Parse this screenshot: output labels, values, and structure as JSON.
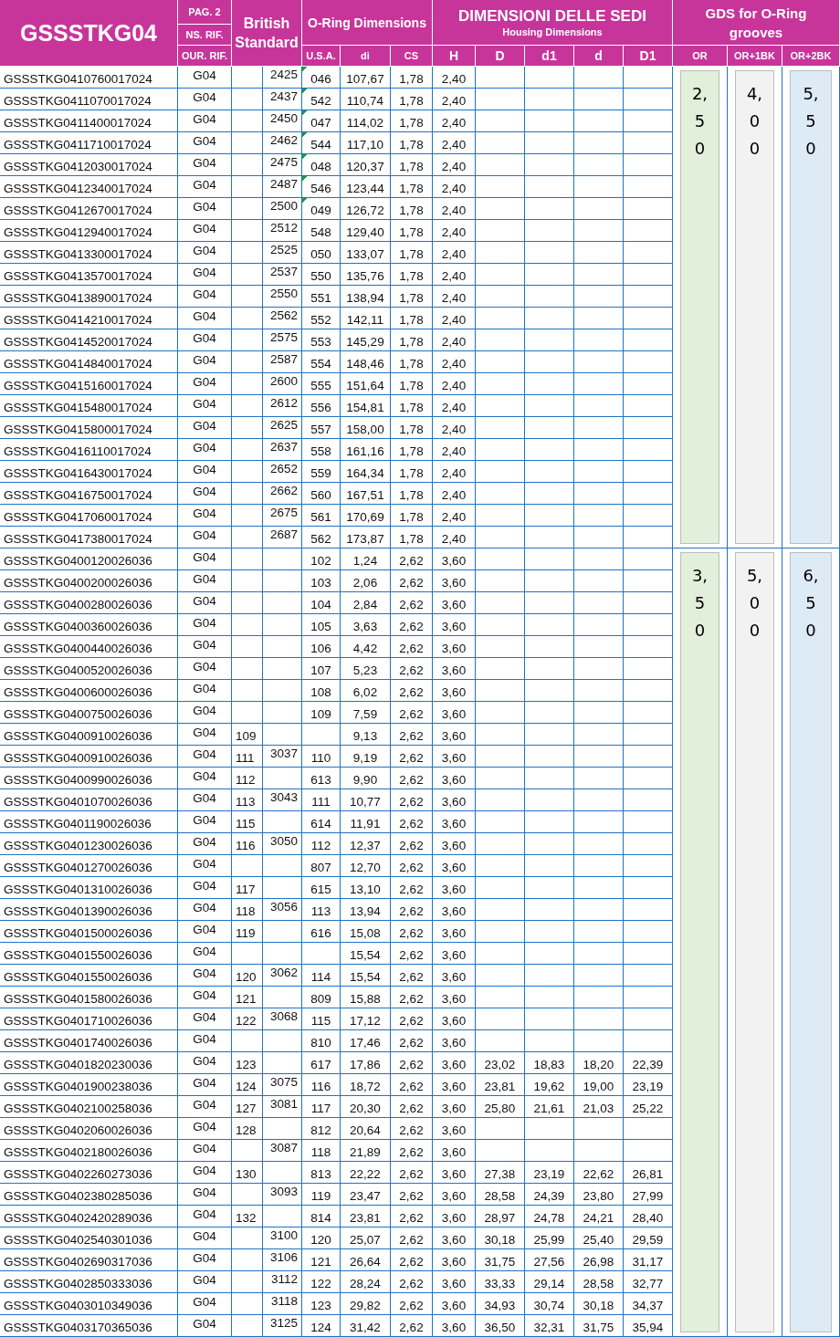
{
  "header": {
    "title": "GSSSTKG04",
    "ref_labels": [
      "PAG. 2",
      "NS. RIF.",
      "OUR. RIF."
    ],
    "bs_title": "British Standard",
    "oring_title": "O-Ring Dimensions",
    "oring_columns": [
      "U.S.A.",
      "di",
      "CS"
    ],
    "housing_title": "DIMENSIONI DELLE SEDI",
    "housing_subtitle": "Housing Dimensions",
    "housing_columns": [
      "H",
      "D",
      "d1",
      "d",
      "D1"
    ],
    "grooves_title": "GDS for O-Ring grooves",
    "grooves_columns": [
      "OR",
      "OR+1BK",
      "OR+2BK"
    ]
  },
  "sections": [
    {
      "grooves": [
        "2,50",
        "4,00",
        "5,50"
      ],
      "rows": [
        {
          "code": "GSSSTKG0410760017024",
          "ref": "G04",
          "bs_b": "2425",
          "usa": "046",
          "di": "107,67",
          "cs": "1,78",
          "H": "2,40",
          "flagged": true
        },
        {
          "code": "GSSSTKG0411070017024",
          "ref": "G04",
          "bs_b": "2437",
          "usa": "542",
          "di": "110,74",
          "cs": "1,78",
          "H": "2,40",
          "flagged": true
        },
        {
          "code": "GSSSTKG0411400017024",
          "ref": "G04",
          "bs_b": "2450",
          "usa": "047",
          "di": "114,02",
          "cs": "1,78",
          "H": "2,40",
          "flagged": true
        },
        {
          "code": "GSSSTKG0411710017024",
          "ref": "G04",
          "bs_b": "2462",
          "usa": "544",
          "di": "117,10",
          "cs": "1,78",
          "H": "2,40",
          "flagged": true
        },
        {
          "code": "GSSSTKG0412030017024",
          "ref": "G04",
          "bs_b": "2475",
          "usa": "048",
          "di": "120,37",
          "cs": "1,78",
          "H": "2,40",
          "flagged": true
        },
        {
          "code": "GSSSTKG0412340017024",
          "ref": "G04",
          "bs_b": "2487",
          "usa": "546",
          "di": "123,44",
          "cs": "1,78",
          "H": "2,40",
          "flagged": true
        },
        {
          "code": "GSSSTKG0412670017024",
          "ref": "G04",
          "bs_b": "2500",
          "usa": "049",
          "di": "126,72",
          "cs": "1,78",
          "H": "2,40",
          "flagged": true
        },
        {
          "code": "GSSSTKG0412940017024",
          "ref": "G04",
          "bs_b": "2512",
          "usa": "548",
          "di": "129,40",
          "cs": "1,78",
          "H": "2,40",
          "flagged": false
        },
        {
          "code": "GSSSTKG0413300017024",
          "ref": "G04",
          "bs_b": "2525",
          "usa": "050",
          "di": "133,07",
          "cs": "1,78",
          "H": "2,40",
          "flagged": false
        },
        {
          "code": "GSSSTKG0413570017024",
          "ref": "G04",
          "bs_b": "2537",
          "usa": "550",
          "di": "135,76",
          "cs": "1,78",
          "H": "2,40",
          "flagged": false
        },
        {
          "code": "GSSSTKG0413890017024",
          "ref": "G04",
          "bs_b": "2550",
          "usa": "551",
          "di": "138,94",
          "cs": "1,78",
          "H": "2,40",
          "flagged": false
        },
        {
          "code": "GSSSTKG0414210017024",
          "ref": "G04",
          "bs_b": "2562",
          "usa": "552",
          "di": "142,11",
          "cs": "1,78",
          "H": "2,40",
          "flagged": false
        },
        {
          "code": "GSSSTKG0414520017024",
          "ref": "G04",
          "bs_b": "2575",
          "usa": "553",
          "di": "145,29",
          "cs": "1,78",
          "H": "2,40",
          "flagged": false
        },
        {
          "code": "GSSSTKG0414840017024",
          "ref": "G04",
          "bs_b": "2587",
          "usa": "554",
          "di": "148,46",
          "cs": "1,78",
          "H": "2,40",
          "flagged": false
        },
        {
          "code": "GSSSTKG0415160017024",
          "ref": "G04",
          "bs_b": "2600",
          "usa": "555",
          "di": "151,64",
          "cs": "1,78",
          "H": "2,40",
          "flagged": false
        },
        {
          "code": "GSSSTKG0415480017024",
          "ref": "G04",
          "bs_b": "2612",
          "usa": "556",
          "di": "154,81",
          "cs": "1,78",
          "H": "2,40",
          "flagged": false
        },
        {
          "code": "GSSSTKG0415800017024",
          "ref": "G04",
          "bs_b": "2625",
          "usa": "557",
          "di": "158,00",
          "cs": "1,78",
          "H": "2,40",
          "flagged": false
        },
        {
          "code": "GSSSTKG0416110017024",
          "ref": "G04",
          "bs_b": "2637",
          "usa": "558",
          "di": "161,16",
          "cs": "1,78",
          "H": "2,40",
          "flagged": false
        },
        {
          "code": "GSSSTKG0416430017024",
          "ref": "G04",
          "bs_b": "2652",
          "usa": "559",
          "di": "164,34",
          "cs": "1,78",
          "H": "2,40",
          "flagged": false
        },
        {
          "code": "GSSSTKG0416750017024",
          "ref": "G04",
          "bs_b": "2662",
          "usa": "560",
          "di": "167,51",
          "cs": "1,78",
          "H": "2,40",
          "flagged": false
        },
        {
          "code": "GSSSTKG0417060017024",
          "ref": "G04",
          "bs_b": "2675",
          "usa": "561",
          "di": "170,69",
          "cs": "1,78",
          "H": "2,40",
          "flagged": false
        },
        {
          "code": "GSSSTKG0417380017024",
          "ref": "G04",
          "bs_b": "2687",
          "usa": "562",
          "di": "173,87",
          "cs": "1,78",
          "H": "2,40",
          "flagged": false
        }
      ]
    },
    {
      "grooves": [
        "3,50",
        "5,00",
        "6,50"
      ],
      "rows": [
        {
          "code": "GSSSTKG0400120026036",
          "ref": "G04",
          "usa": "102",
          "di": "1,24",
          "cs": "2,62",
          "H": "3,60",
          "flagged": false
        },
        {
          "code": "GSSSTKG0400200026036",
          "ref": "G04",
          "usa": "103",
          "di": "2,06",
          "cs": "2,62",
          "H": "3,60",
          "flagged": false
        },
        {
          "code": "GSSSTKG0400280026036",
          "ref": "G04",
          "usa": "104",
          "di": "2,84",
          "cs": "2,62",
          "H": "3,60",
          "flagged": false
        },
        {
          "code": "GSSSTKG0400360026036",
          "ref": "G04",
          "usa": "105",
          "di": "3,63",
          "cs": "2,62",
          "H": "3,60",
          "flagged": false
        },
        {
          "code": "GSSSTKG0400440026036",
          "ref": "G04",
          "usa": "106",
          "di": "4,42",
          "cs": "2,62",
          "H": "3,60",
          "flagged": false
        },
        {
          "code": "GSSSTKG0400520026036",
          "ref": "G04",
          "usa": "107",
          "di": "5,23",
          "cs": "2,62",
          "H": "3,60",
          "flagged": false
        },
        {
          "code": "GSSSTKG0400600026036",
          "ref": "G04",
          "usa": "108",
          "di": "6,02",
          "cs": "2,62",
          "H": "3,60",
          "flagged": false
        },
        {
          "code": "GSSSTKG0400750026036",
          "ref": "G04",
          "usa": "109",
          "di": "7,59",
          "cs": "2,62",
          "H": "3,60",
          "flagged": false
        },
        {
          "code": "GSSSTKG0400910026036",
          "ref": "G04",
          "bs_a": "109",
          "di": "9,13",
          "cs": "2,62",
          "H": "3,60",
          "flagged": false
        },
        {
          "code": "GSSSTKG0400910026036",
          "ref": "G04",
          "bs_a": "111",
          "bs_b": "3037",
          "usa": "110",
          "di": "9,19",
          "cs": "2,62",
          "H": "3,60",
          "flagged": false
        },
        {
          "code": "GSSSTKG0400990026036",
          "ref": "G04",
          "bs_a": "112",
          "usa": "613",
          "di": "9,90",
          "cs": "2,62",
          "H": "3,60",
          "flagged": false
        },
        {
          "code": "GSSSTKG0401070026036",
          "ref": "G04",
          "bs_a": "113",
          "bs_b": "3043",
          "usa": "111",
          "di": "10,77",
          "cs": "2,62",
          "H": "3,60",
          "flagged": false
        },
        {
          "code": "GSSSTKG0401190026036",
          "ref": "G04",
          "bs_a": "115",
          "usa": "614",
          "di": "11,91",
          "cs": "2,62",
          "H": "3,60",
          "flagged": false
        },
        {
          "code": "GSSSTKG0401230026036",
          "ref": "G04",
          "bs_a": "116",
          "bs_b": "3050",
          "usa": "112",
          "di": "12,37",
          "cs": "2,62",
          "H": "3,60",
          "flagged": false
        },
        {
          "code": "GSSSTKG0401270026036",
          "ref": "G04",
          "usa": "807",
          "di": "12,70",
          "cs": "2,62",
          "H": "3,60",
          "flagged": false
        },
        {
          "code": "GSSSTKG0401310026036",
          "ref": "G04",
          "bs_a": "117",
          "usa": "615",
          "di": "13,10",
          "cs": "2,62",
          "H": "3,60",
          "flagged": false
        },
        {
          "code": "GSSSTKG0401390026036",
          "ref": "G04",
          "bs_a": "118",
          "bs_b": "3056",
          "usa": "113",
          "di": "13,94",
          "cs": "2,62",
          "H": "3,60",
          "flagged": false
        },
        {
          "code": "GSSSTKG0401500026036",
          "ref": "G04",
          "bs_a": "119",
          "usa": "616",
          "di": "15,08",
          "cs": "2,62",
          "H": "3,60",
          "flagged": false
        },
        {
          "code": "GSSSTKG0401550026036",
          "ref": "G04",
          "di": "15,54",
          "cs": "2,62",
          "H": "3,60",
          "flagged": false
        },
        {
          "code": "GSSSTKG0401550026036",
          "ref": "G04",
          "bs_a": "120",
          "bs_b": "3062",
          "usa": "114",
          "di": "15,54",
          "cs": "2,62",
          "H": "3,60",
          "flagged": false
        },
        {
          "code": "GSSSTKG0401580026036",
          "ref": "G04",
          "bs_a": "121",
          "usa": "809",
          "di": "15,88",
          "cs": "2,62",
          "H": "3,60",
          "flagged": false
        },
        {
          "code": "GSSSTKG0401710026036",
          "ref": "G04",
          "bs_a": "122",
          "bs_b": "3068",
          "usa": "115",
          "di": "17,12",
          "cs": "2,62",
          "H": "3,60",
          "flagged": false
        },
        {
          "code": "GSSSTKG0401740026036",
          "ref": "G04",
          "usa": "810",
          "di": "17,46",
          "cs": "2,62",
          "H": "3,60",
          "flagged": false
        },
        {
          "code": "GSSSTKG0401820230036",
          "ref": "G04",
          "bs_a": "123",
          "usa": "617",
          "di": "17,86",
          "cs": "2,62",
          "H": "3,60",
          "D": "23,02",
          "d1": "18,83",
          "d": "18,20",
          "D1": "22,39",
          "flagged": false
        },
        {
          "code": "GSSSTKG0401900238036",
          "ref": "G04",
          "bs_a": "124",
          "bs_b": "3075",
          "usa": "116",
          "di": "18,72",
          "cs": "2,62",
          "H": "3,60",
          "D": "23,81",
          "d1": "19,62",
          "d": "19,00",
          "D1": "23,19",
          "flagged": false
        },
        {
          "code": "GSSSTKG0402100258036",
          "ref": "G04",
          "bs_a": "127",
          "bs_b": "3081",
          "usa": "117",
          "di": "20,30",
          "cs": "2,62",
          "H": "3,60",
          "D": "25,80",
          "d1": "21,61",
          "d": "21,03",
          "D1": "25,22",
          "flagged": false
        },
        {
          "code": "GSSSTKG0402060026036",
          "ref": "G04",
          "bs_a": "128",
          "usa": "812",
          "di": "20,64",
          "cs": "2,62",
          "H": "3,60",
          "flagged": false
        },
        {
          "code": "GSSSTKG0402180026036",
          "ref": "G04",
          "bs_b": "3087",
          "usa": "118",
          "di": "21,89",
          "cs": "2,62",
          "H": "3,60",
          "flagged": false
        },
        {
          "code": "GSSSTKG0402260273036",
          "ref": "G04",
          "bs_a": "130",
          "usa": "813",
          "di": "22,22",
          "cs": "2,62",
          "H": "3,60",
          "D": "27,38",
          "d1": "23,19",
          "d": "22,62",
          "D1": "26,81",
          "flagged": false
        },
        {
          "code": "GSSSTKG0402380285036",
          "ref": "G04",
          "bs_b": "3093",
          "usa": "119",
          "di": "23,47",
          "cs": "2,62",
          "H": "3,60",
          "D": "28,58",
          "d1": "24,39",
          "d": "23,80",
          "D1": "27,99",
          "flagged": false
        },
        {
          "code": "GSSSTKG0402420289036",
          "ref": "G04",
          "bs_a": "132",
          "usa": "814",
          "di": "23,81",
          "cs": "2,62",
          "H": "3,60",
          "D": "28,97",
          "d1": "24,78",
          "d": "24,21",
          "D1": "28,40",
          "flagged": false
        },
        {
          "code": "GSSSTKG0402540301036",
          "ref": "G04",
          "bs_b": "3100",
          "usa": "120",
          "di": "25,07",
          "cs": "2,62",
          "H": "3,60",
          "D": "30,18",
          "d1": "25,99",
          "d": "25,40",
          "D1": "29,59",
          "flagged": false
        },
        {
          "code": "GSSSTKG0402690317036",
          "ref": "G04",
          "bs_b": "3106",
          "usa": "121",
          "di": "26,64",
          "cs": "2,62",
          "H": "3,60",
          "D": "31,75",
          "d1": "27,56",
          "d": "26,98",
          "D1": "31,17",
          "flagged": false
        },
        {
          "code": "GSSSTKG0402850333036",
          "ref": "G04",
          "bs_b": "3112",
          "usa": "122",
          "di": "28,24",
          "cs": "2,62",
          "H": "3,60",
          "D": "33,33",
          "d1": "29,14",
          "d": "28,58",
          "D1": "32,77",
          "flagged": false
        },
        {
          "code": "GSSSTKG0403010349036",
          "ref": "G04",
          "bs_b": "3118",
          "usa": "123",
          "di": "29,82",
          "cs": "2,62",
          "H": "3,60",
          "D": "34,93",
          "d1": "30,74",
          "d": "30,18",
          "D1": "34,37",
          "flagged": false
        },
        {
          "code": "GSSSTKG0403170365036",
          "ref": "G04",
          "bs_b": "3125",
          "usa": "124",
          "di": "31,42",
          "cs": "2,62",
          "H": "3,60",
          "D": "36,50",
          "d1": "32,31",
          "d": "31,75",
          "D1": "35,94",
          "flagged": false
        }
      ]
    }
  ]
}
